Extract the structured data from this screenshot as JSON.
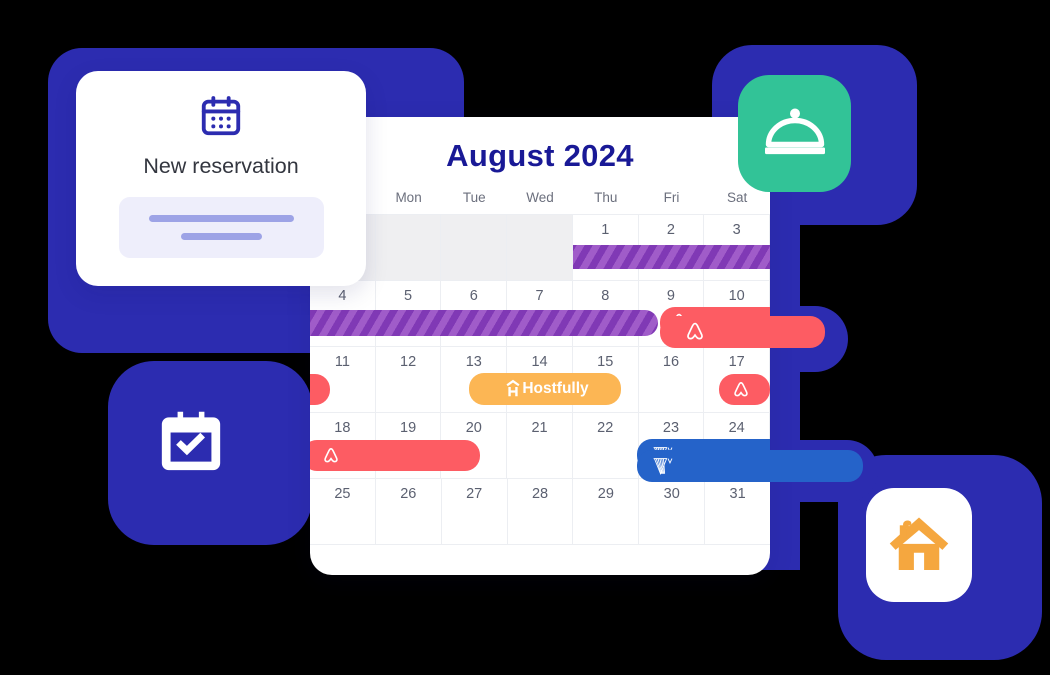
{
  "colors": {
    "brand_blue": "#2c2cb0",
    "title_navy": "#191996",
    "airbnb_red": "#fd5c63",
    "vrbo_blue": "#2563c9",
    "hostfully_orange": "#fcb654",
    "blocked_purple": "#8039b5",
    "cloche_green": "#32c397",
    "house_orange": "#f5a73f"
  },
  "reservation_card": {
    "icon": "calendar-icon",
    "title": "New reservation",
    "skeleton_lines": 2
  },
  "calendar": {
    "title": "August 2024",
    "weekdays": [
      "",
      "Mon",
      "Tue",
      "Wed",
      "Thu",
      "Fri",
      "Sat"
    ],
    "weeks": [
      {
        "days": [
          "",
          "",
          "",
          "",
          "1",
          "2",
          "3"
        ]
      },
      {
        "days": [
          "4",
          "5",
          "6",
          "7",
          "8",
          "9",
          "10"
        ]
      },
      {
        "days": [
          "11",
          "12",
          "13",
          "14",
          "15",
          "16",
          "17"
        ]
      },
      {
        "days": [
          "18",
          "19",
          "20",
          "21",
          "22",
          "23",
          "24"
        ]
      },
      {
        "days": [
          "25",
          "26",
          "27",
          "28",
          "29",
          "30",
          "31"
        ]
      }
    ],
    "bookings": [
      {
        "id": "blocked-aug1-3",
        "week": 0,
        "label": "",
        "channel": "blocked",
        "icon": ""
      },
      {
        "id": "blocked-aug4-8",
        "week": 1,
        "label": "",
        "channel": "blocked",
        "icon": ""
      },
      {
        "id": "airbnb-aug9-11",
        "week": 1,
        "label": "",
        "channel": "airbnb",
        "icon": "airbnb-icon"
      },
      {
        "id": "airbnb-aug11-cont",
        "week": 2,
        "label": "",
        "channel": "airbnb",
        "icon": ""
      },
      {
        "id": "hostfully-aug13-15",
        "week": 2,
        "label": "Hostfully",
        "channel": "hostfully",
        "icon": "hostfully-icon"
      },
      {
        "id": "airbnb-aug17",
        "week": 2,
        "label": "",
        "channel": "airbnb",
        "icon": "airbnb-icon"
      },
      {
        "id": "airbnb-aug18-20",
        "week": 3,
        "label": "",
        "channel": "airbnb",
        "icon": "airbnb-icon"
      },
      {
        "id": "vrbo-aug23-26",
        "week": 3,
        "label": "",
        "channel": "vrbo",
        "icon": "vrbo-icon"
      }
    ]
  },
  "floating_tiles": [
    {
      "id": "cloche",
      "icon": "cloche-icon",
      "background": "#32c397"
    },
    {
      "id": "calendar-check",
      "icon": "calendar-check-icon",
      "background": "#2c2cb0"
    },
    {
      "id": "house",
      "icon": "house-icon",
      "background": "#ffffff"
    }
  ]
}
